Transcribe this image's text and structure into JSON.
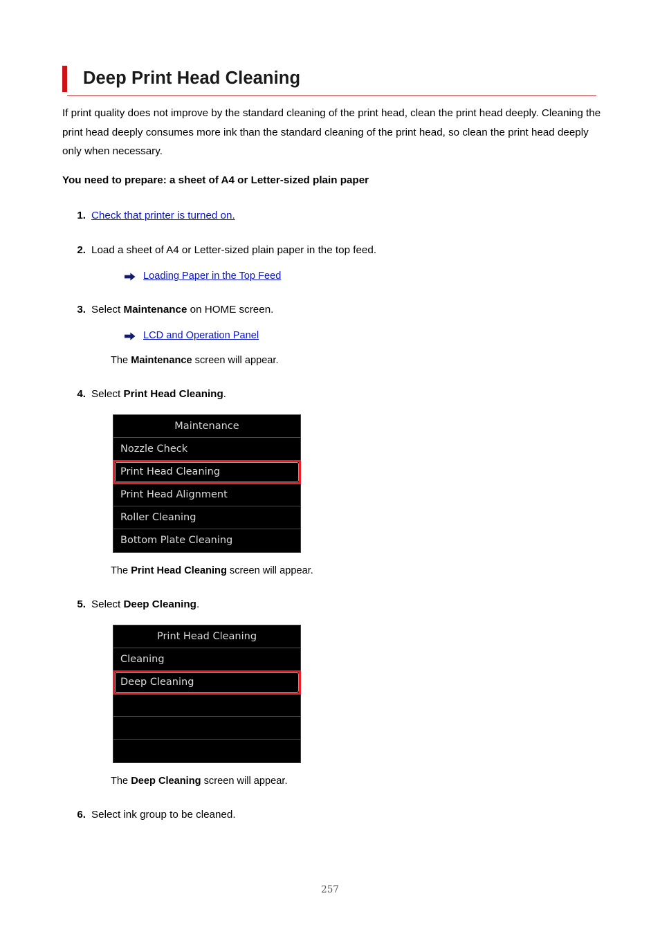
{
  "page": {
    "title": "Deep Print Head Cleaning",
    "page_number": "257",
    "accent_color": "#cc1117",
    "rule_color": "#b03034",
    "link_color": "#0914c9"
  },
  "intro": {
    "paragraph": "If print quality does not improve by the standard cleaning of the print head, clean the print head deeply. Cleaning the print head deeply consumes more ink than the standard cleaning of the print head, so clean the print head deeply only when necessary.",
    "prepare": "You need to prepare: a sheet of A4 or Letter-sized plain paper"
  },
  "steps": [
    {
      "num": "1.",
      "link": "Check that printer is turned on."
    },
    {
      "num": "2.",
      "text_plain": "Load a sheet of A4 or Letter-sized plain paper in the top feed.",
      "sublink": "Loading Paper in the Top Feed",
      "sublink_icon": "arrow-right-icon"
    },
    {
      "num": "3.",
      "text_pre": "Select ",
      "text_bold": "Maintenance",
      "text_post": " on HOME screen.",
      "sublink": "LCD and Operation Panel",
      "sublink_icon": "arrow-right-icon",
      "note_pre": "The ",
      "note_bold": "Maintenance",
      "note_post": " screen will appear."
    },
    {
      "num": "4.",
      "text_pre": "Select ",
      "text_bold": "Print Head Cleaning",
      "text_post": ".",
      "note_pre": "The ",
      "note_bold": "Print Head Cleaning",
      "note_post": " screen will appear."
    },
    {
      "num": "5.",
      "text_pre": "Select ",
      "text_bold": "Deep Cleaning",
      "text_post": ".",
      "note_pre": "The ",
      "note_bold": "Deep Cleaning",
      "note_post": " screen will appear."
    },
    {
      "num": "6.",
      "text_plain": "Select ink group to be cleaned."
    }
  ],
  "lcd_maintenance": {
    "title": "Maintenance",
    "selected_index": 1,
    "rows": [
      {
        "label": "Nozzle Check",
        "selected": false
      },
      {
        "label": "Print Head Cleaning",
        "selected": true
      },
      {
        "label": "Print Head Alignment",
        "selected": false
      },
      {
        "label": "Roller Cleaning",
        "selected": false
      },
      {
        "label": "Bottom Plate Cleaning",
        "selected": false
      }
    ]
  },
  "lcd_print_head_cleaning": {
    "title": "Print Head Cleaning",
    "selected_index": 1,
    "rows": [
      {
        "label": "Cleaning",
        "selected": false
      },
      {
        "label": "Deep Cleaning",
        "selected": true
      },
      {
        "label": "",
        "selected": false
      },
      {
        "label": "",
        "selected": false
      },
      {
        "label": "",
        "selected": false
      }
    ]
  }
}
